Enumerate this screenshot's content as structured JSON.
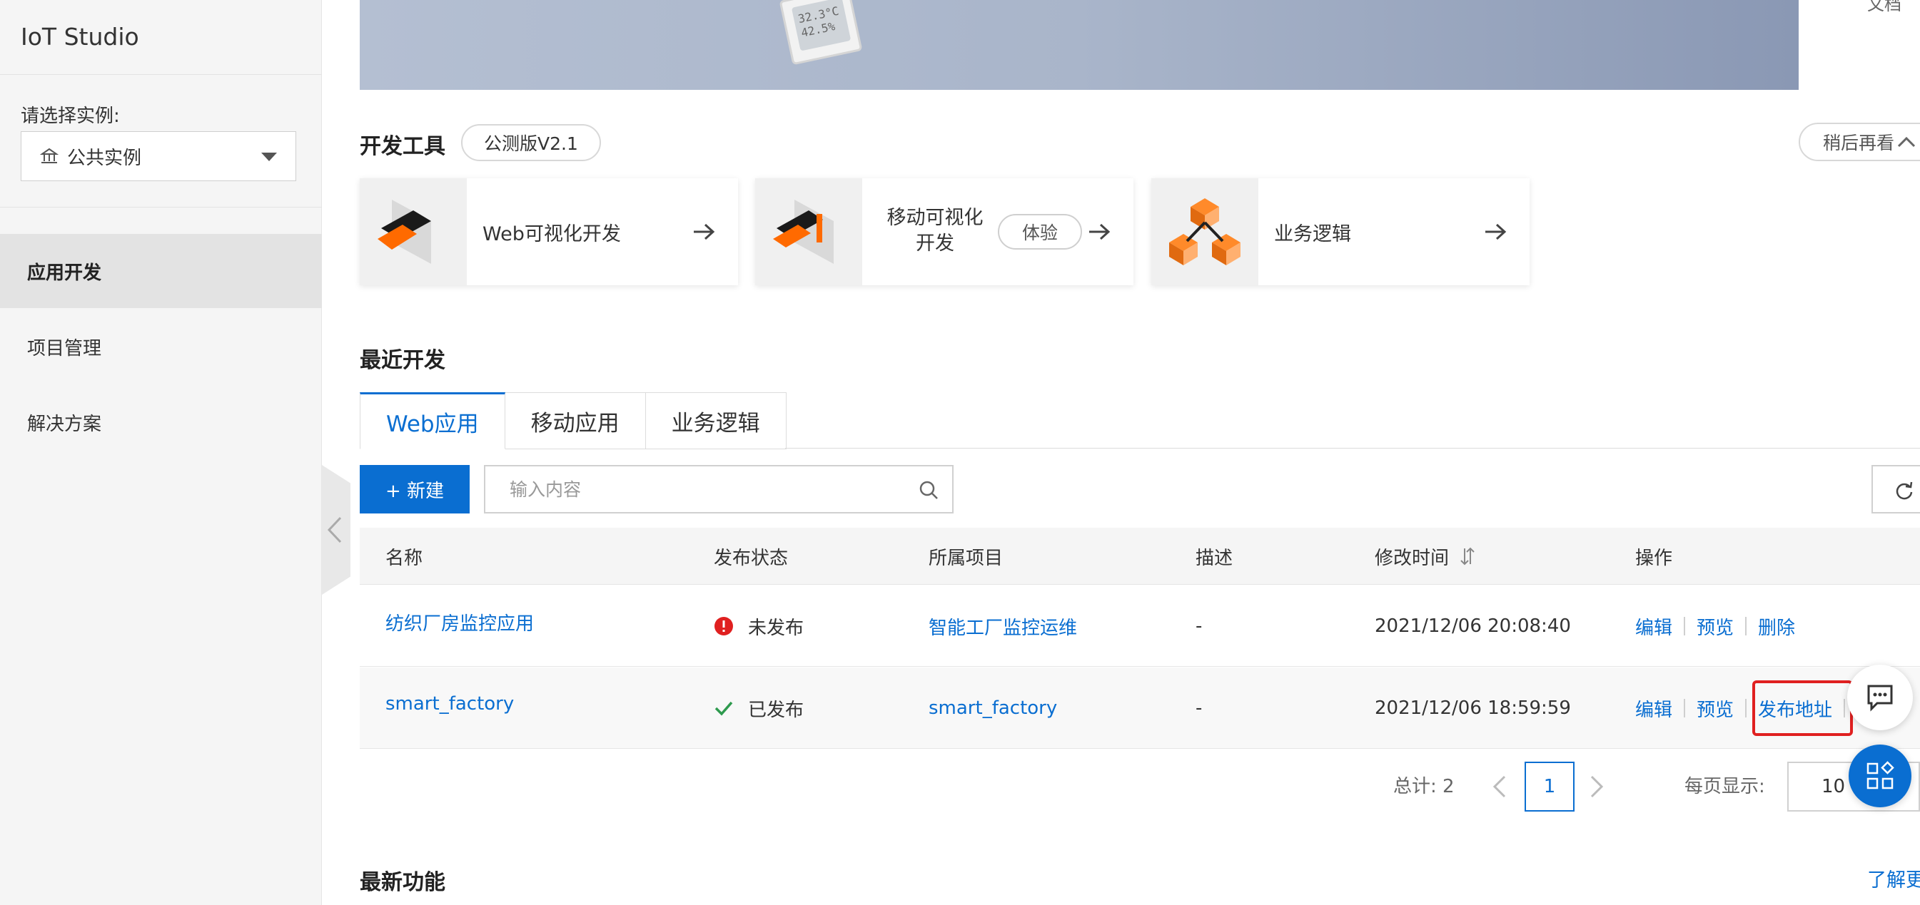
{
  "app": {
    "title": "IoT Studio"
  },
  "sidebar": {
    "instance_label": "请选择实例:",
    "instance_value": "公共实例",
    "items": [
      {
        "label": "应用开发",
        "active": true
      },
      {
        "label": "项目管理",
        "active": false
      },
      {
        "label": "解决方案",
        "active": false
      }
    ]
  },
  "banner": {
    "device_lines": [
      "32.3°C",
      "42.5%"
    ],
    "right_partial": "文档"
  },
  "dev_tools": {
    "title": "开发工具",
    "version_pill": "公测版V2.1",
    "later_label": "稍后再看",
    "cards": [
      {
        "label": "Web可视化开发"
      },
      {
        "label": "移动可视化开发",
        "badge": "体验"
      },
      {
        "label": "业务逻辑"
      }
    ]
  },
  "recent": {
    "title": "最近开发",
    "tabs": [
      {
        "label": "Web应用",
        "active": true
      },
      {
        "label": "移动应用",
        "active": false
      },
      {
        "label": "业务逻辑",
        "active": false
      }
    ],
    "new_button": "+ 新建",
    "search_placeholder": "输入内容",
    "columns": [
      "名称",
      "发布状态",
      "所属项目",
      "描述",
      "修改时间",
      "操作"
    ],
    "rows": [
      {
        "name": "纺织厂房监控应用",
        "status": "未发布",
        "status_type": "error",
        "project": "智能工厂监控运维",
        "description": "-",
        "modified": "2021/12/06 20:08:40",
        "actions": [
          "编辑",
          "预览",
          "删除"
        ]
      },
      {
        "name": "smart_factory",
        "status": "已发布",
        "status_type": "success",
        "project": "smart_factory",
        "description": "-",
        "modified": "2021/12/06 18:59:59",
        "actions": [
          "编辑",
          "预览",
          "发布地址"
        ]
      }
    ],
    "pagination": {
      "total_label": "总计: 2",
      "current_page": "1",
      "page_size_label": "每页显示:",
      "page_size": "10"
    }
  },
  "new_features": {
    "title": "最新功能",
    "learn_more": "了解更多"
  },
  "colors": {
    "accent": "#0a6ed1",
    "error": "#e02020",
    "success": "#2e9a4e",
    "sidebar_bg": "#f5f5f5"
  }
}
